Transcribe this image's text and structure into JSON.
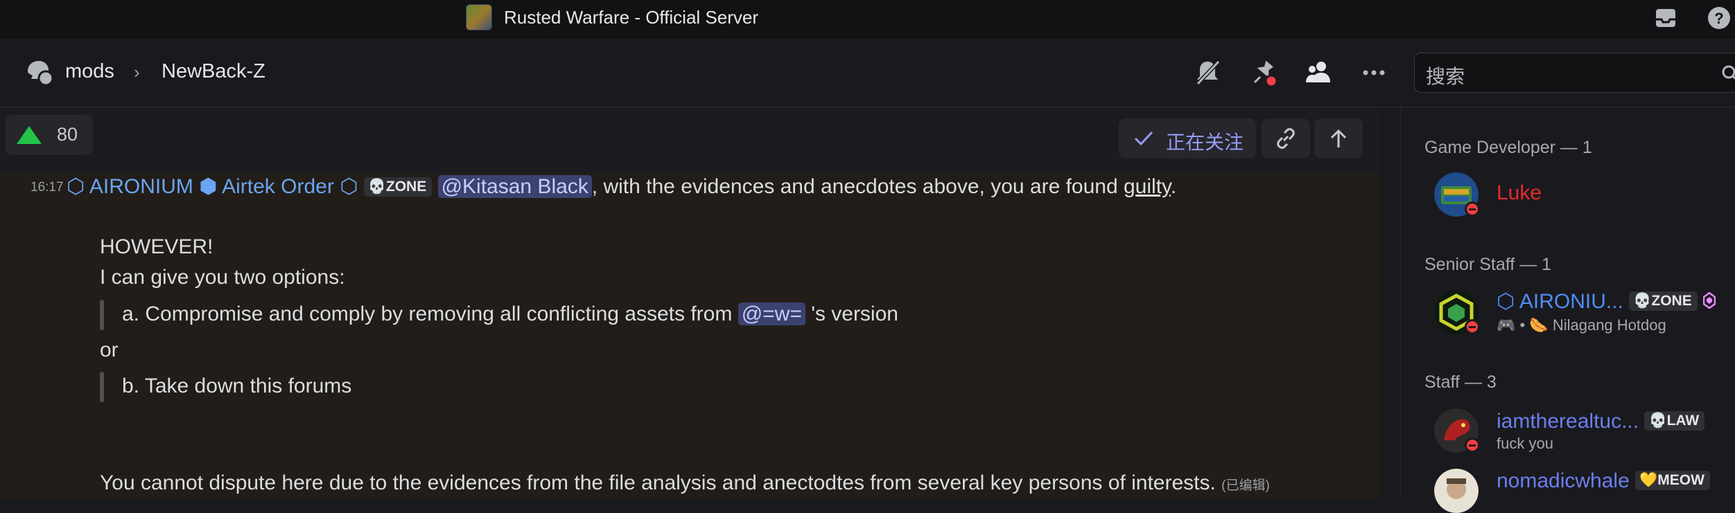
{
  "window": {
    "title": "Rusted Warfare - Official Server"
  },
  "header": {
    "channel": "mods",
    "separator": "›",
    "thread": "NewBack-Z",
    "search_placeholder": "搜索"
  },
  "post_toolbar": {
    "votes": "80",
    "follow_label": "正在关注"
  },
  "message": {
    "time": "16:17",
    "author_prefix_icon": "⬡",
    "author": "AIRONIUM",
    "clan_icon": "⬢",
    "clan": "Airtek Order",
    "clan_suffix_icon": "⬡",
    "tag_emoji": "💀",
    "tag": "ZONE",
    "mention1": "@Kitasan Black",
    "line1_pre": ", with the evidences and anecdotes above, you are found ",
    "line1_guilty": "guilty",
    "line1_end": ".",
    "line2": "HOWEVER!",
    "line3": "I can give you two options:",
    "opt_a_pre": "a. Compromise and comply by removing all conflicting assets from ",
    "mention2": "@=w=",
    "opt_a_post": " 's version",
    "or": "or",
    "opt_b": "b. Take down this forums",
    "final": "You cannot dispute here due to the evidences from the file analysis and anectodtes from several key persons of interests. ",
    "edited": "(已编辑)"
  },
  "members": {
    "sections": [
      {
        "title": "Game Developer — 1"
      },
      {
        "title": "Senior Staff — 1"
      },
      {
        "title": "Staff — 3"
      }
    ],
    "luke": {
      "name": "Luke"
    },
    "aironium": {
      "name": "⬡ AIRONIU...",
      "tag_emoji": "💀",
      "tag": "ZONE",
      "status_emoji": "🎮 • 🌭",
      "status": " Nilagang Hotdog"
    },
    "iamthe": {
      "name": "iamtherealtuc...",
      "tag_emoji": "💀",
      "tag": "LAW",
      "status": "fuck you"
    },
    "nomadic": {
      "name": "nomadicwhale",
      "tag_emoji": "💛",
      "tag": "MEOW"
    }
  },
  "colors": {
    "accent": "#949cf7",
    "role_developer": "#e52a2a",
    "role_senior": "#4f8ef7",
    "role_staff": "#6b7ff0",
    "dnd": "#f23f43",
    "upvote": "#23c34a"
  }
}
